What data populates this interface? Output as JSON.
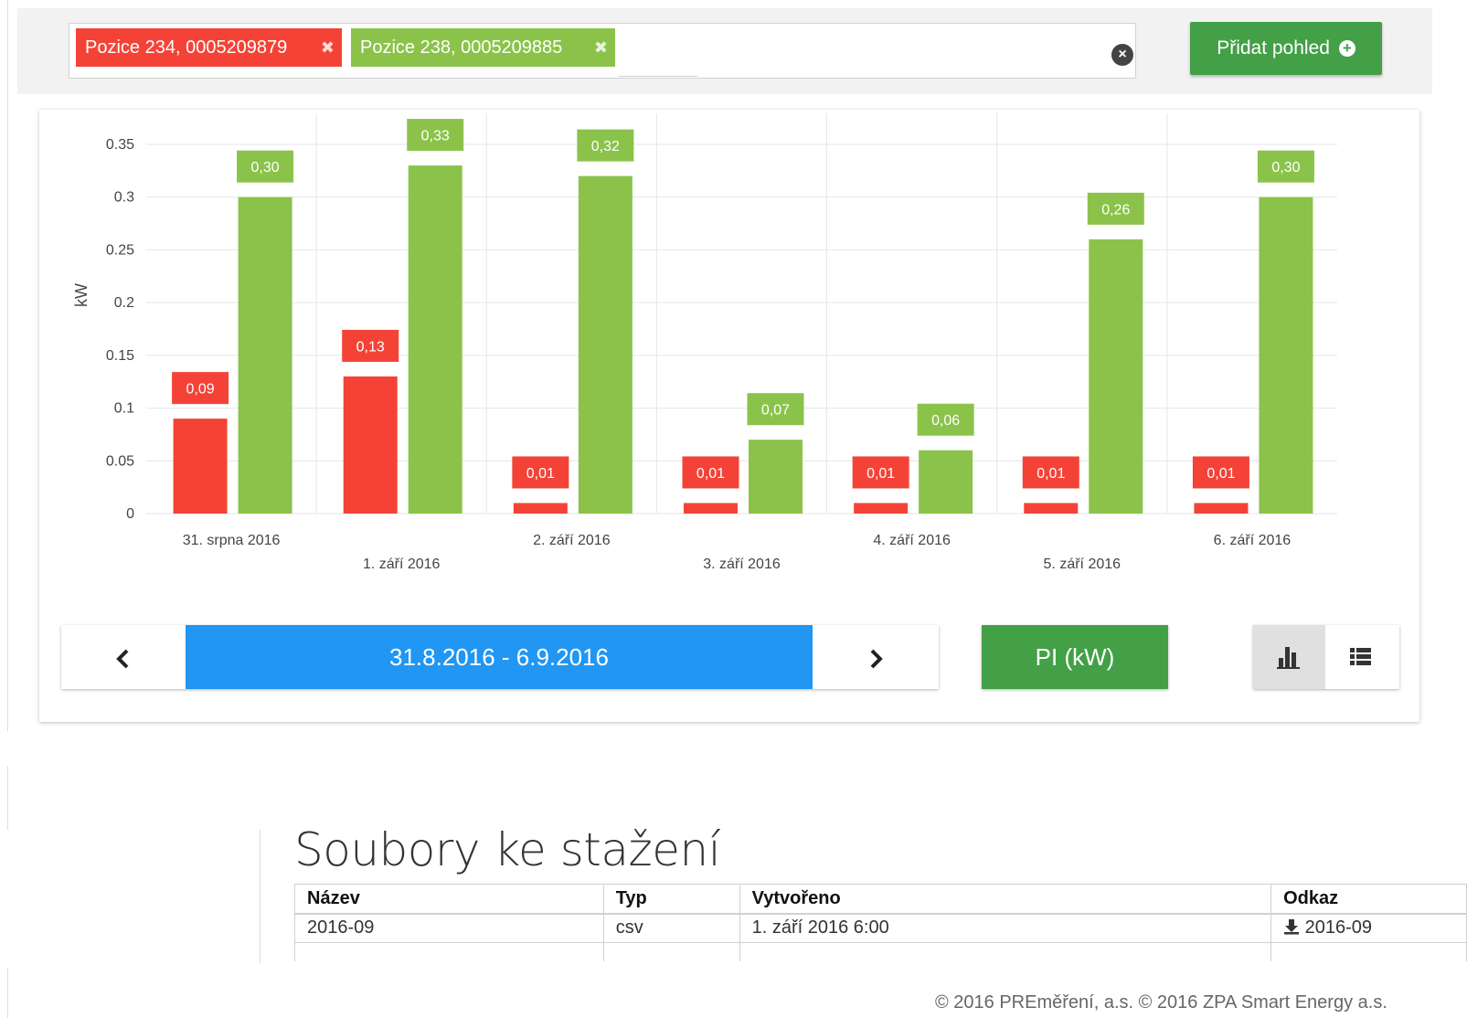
{
  "filters": {
    "tags": [
      {
        "label": "Pozice 234, 0005209879",
        "color": "#f44336"
      },
      {
        "label": "Pozice 238, 0005209885",
        "color": "#8bc34a"
      }
    ],
    "remove_glyph": "✖",
    "clear_glyph": "×",
    "add_view_label": "Přidat pohled",
    "add_view_glyph": "+"
  },
  "chart_data": {
    "type": "bar",
    "ylabel": "kW",
    "ylim": [
      0,
      0.35
    ],
    "yticks": [
      "0",
      "0.05",
      "0.1",
      "0.15",
      "0.2",
      "0.25",
      "0.3",
      "0.35"
    ],
    "ytick_values": [
      0,
      0.05,
      0.1,
      0.15,
      0.2,
      0.25,
      0.3,
      0.35
    ],
    "categories": [
      "31. srpna 2016",
      "1. září 2016",
      "2. září 2016",
      "3. září 2016",
      "4. září 2016",
      "5. září 2016",
      "6. září 2016"
    ],
    "series": [
      {
        "values": [
          0.09,
          0.13,
          0.01,
          0.01,
          0.01,
          0.01,
          0.01
        ],
        "labels": [
          "0,09",
          "0,13",
          "0,01",
          "0,01",
          "0,01",
          "0,01",
          "0,01"
        ],
        "color": "#f44336"
      },
      {
        "values": [
          0.3,
          0.33,
          0.32,
          0.07,
          0.06,
          0.26,
          0.3
        ],
        "labels": [
          "0,30",
          "0,33",
          "0,32",
          "0,07",
          "0,06",
          "0,26",
          "0,30"
        ],
        "color": "#8bc34a"
      }
    ],
    "grid": true,
    "legend": "none"
  },
  "controls": {
    "prev_glyph": "‹",
    "date_range": "31.8.2016 - 6.9.2016",
    "next_glyph": "›",
    "unit_label": "PI (kW)",
    "active_view": "chart"
  },
  "downloads": {
    "title": "Soubory ke stažení",
    "columns": [
      "Název",
      "Typ",
      "Vytvořeno",
      "Odkaz"
    ],
    "rows": [
      {
        "name": "2016-09",
        "type": "csv",
        "created": "1. září 2016 6:00",
        "link": "2016-09"
      }
    ]
  },
  "footer": "© 2016 PREměření, a.s. © 2016 ZPA Smart Energy a.s.",
  "colors": {
    "accent_green": "#43a047",
    "accent_blue": "#2196f3",
    "series_red": "#f44336",
    "series_green": "#8bc34a"
  }
}
